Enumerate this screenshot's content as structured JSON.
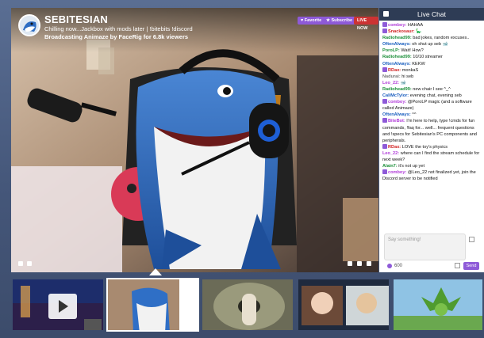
{
  "channel": {
    "name": "SEBITESIAN",
    "status": "Chilling now...Jackbox with mods later | !bitebits !discord",
    "game": "Broadcasting Animaze by FaceRig for 6.8k viewers"
  },
  "actions": {
    "favorite_label": "Favorite",
    "subscribe_label": "Subscribe",
    "live_label": "LIVE NOW"
  },
  "chat": {
    "title": "Live Chat",
    "messages": [
      {
        "user": "comboy:",
        "text": " HAHAA",
        "color": "#b03ad8",
        "icon": "#8e5ad8"
      },
      {
        "user": "Snackosaur:",
        "text": " 🦕",
        "color": "#d01f1f",
        "icon": "#8e5ad8"
      },
      {
        "user": "Radiohead99:",
        "text": " bad jokes, random excuses..",
        "color": "#1c8f3a",
        "icon": ""
      },
      {
        "user": "OftenAlways:",
        "text": " oh shut up seb 🐋",
        "color": "#1a5fbf",
        "icon": ""
      },
      {
        "user": "PoroLP:",
        "text": " Wait! How?",
        "color": "#1c8f3a",
        "icon": ""
      },
      {
        "user": "Radiohead99:",
        "text": " 10/10 streamer",
        "color": "#1c8f3a",
        "icon": ""
      },
      {
        "user": "OftenAlways:",
        "text": " KEKW",
        "color": "#1a5fbf",
        "icon": ""
      },
      {
        "user": "RDax:",
        "text": " monkaS",
        "color": "#d01f1f",
        "icon": "#8e5ad8"
      },
      {
        "user": "Nadurai:",
        "text": " hi seb",
        "color": "#777",
        "icon": ""
      },
      {
        "user": "Leo_22:",
        "text": " 🐋",
        "color": "#b03ad8",
        "icon": ""
      },
      {
        "user": "Radiohead99:",
        "text": " new chair I see ^_^",
        "color": "#1c8f3a",
        "icon": ""
      },
      {
        "user": "CaliMcTylor:",
        "text": " evening chat, evening seb",
        "color": "#1a5fbf",
        "icon": ""
      },
      {
        "user": "comboy:",
        "text": " @PoroLP magic (and a software called Animaze)",
        "color": "#b03ad8",
        "icon": "#8e5ad8"
      },
      {
        "user": "OftenAlways:",
        "text": " ^^",
        "color": "#1a5fbf",
        "icon": ""
      },
      {
        "user": "BiteBot:",
        "text": " I'm here to help, type !cmds for fun commands, !faq for... well... frequent questions and !specs for Sebitesian's PC components and peripherals.",
        "color": "#b03ad8",
        "icon": "#8e5ad8"
      },
      {
        "user": "RDax:",
        "text": " LOVE the toy's physics",
        "color": "#d01f1f",
        "icon": "#8e5ad8"
      },
      {
        "user": "Leo_22:",
        "text": " where can I find the stream schedule for next week?",
        "color": "#b03ad8",
        "icon": ""
      },
      {
        "user": "Alain7:",
        "text": " it's not up yet",
        "color": "#1c8f3a",
        "icon": ""
      },
      {
        "user": "comboy:",
        "text": " @Leo_22 not finalized yet, join the Discord server to be notified",
        "color": "#b03ad8",
        "icon": "#8e5ad8"
      }
    ],
    "input_placeholder": "Say something!",
    "points": "600",
    "send_label": "Send"
  },
  "colors": {
    "accent": "#8e5ad8",
    "live": "#cc3333",
    "chat_header": "#2e3c55"
  }
}
